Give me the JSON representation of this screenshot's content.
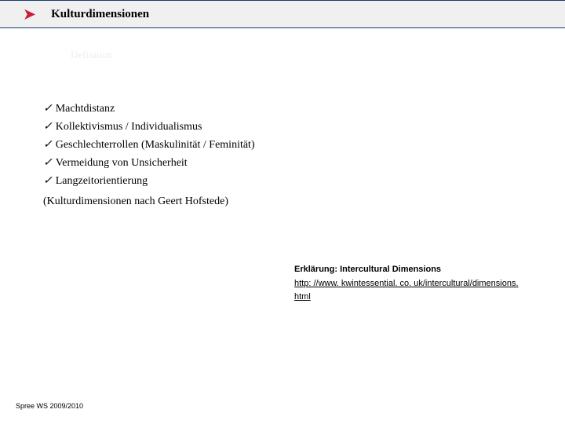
{
  "header": {
    "title": "Kulturdimensionen",
    "icon": "arrow-right"
  },
  "faded_label": "Definition",
  "items": [
    "Machtdistanz",
    "Kollektivismus / Individualismus",
    "Geschlechterrollen (Maskulinität / Feminität)",
    "Vermeidung von Unsicherheit",
    "Langzeitorientierung"
  ],
  "source": "(Kulturdimensionen nach Geert Hofstede)",
  "link": {
    "label": "Erklärung: Intercultural Dimensions",
    "url_line1": "http: //www. kwintessential. co. uk/intercultural/dimensions.",
    "url_line2": "html"
  },
  "footer": "Spree WS 2009/2010"
}
